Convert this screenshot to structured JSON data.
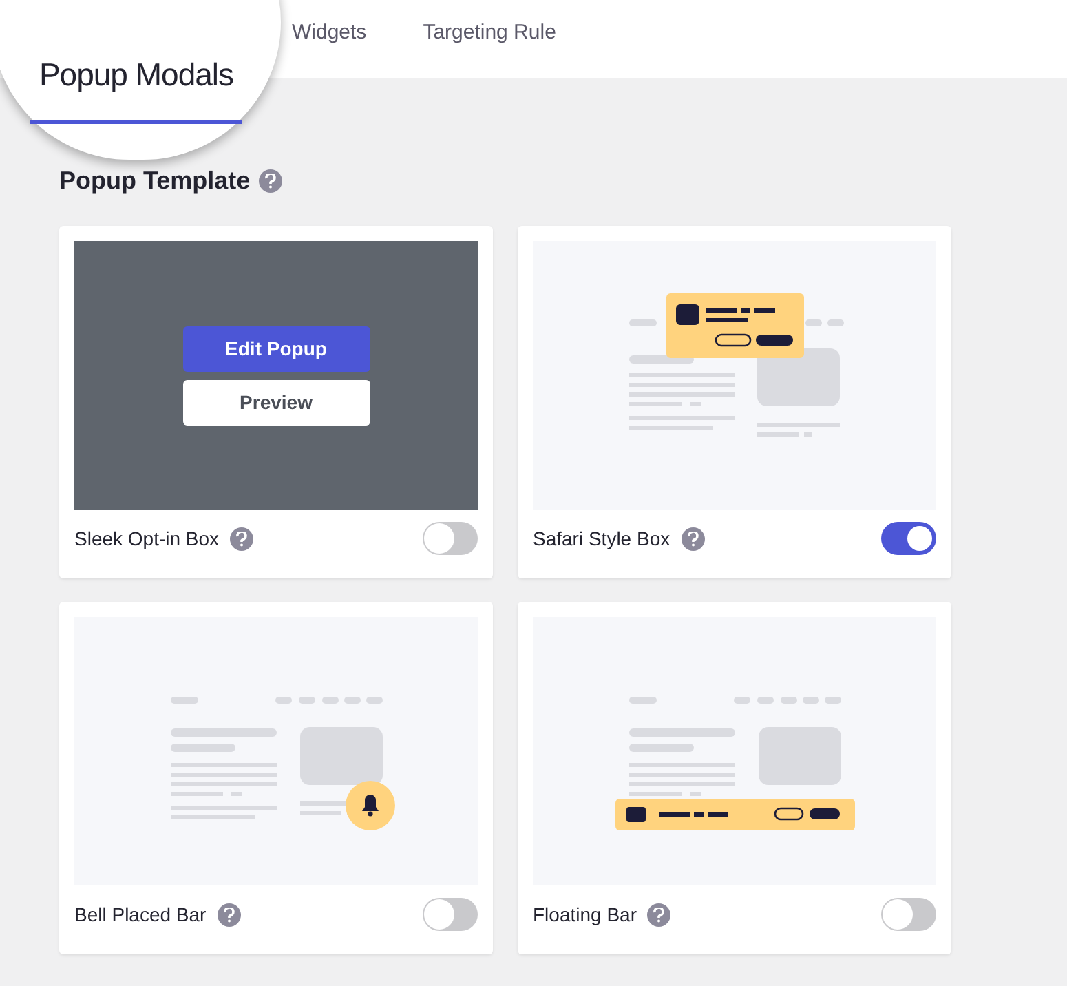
{
  "tabs": [
    {
      "label": "Popup Modals",
      "selected": true
    },
    {
      "label": "Widgets",
      "selected": false
    },
    {
      "label": "Targeting Rule",
      "selected": false
    }
  ],
  "section": {
    "title": "Popup Template"
  },
  "templates": [
    {
      "name": "Sleek Opt-in Box",
      "kind": "overlay",
      "enabled": false,
      "buttons": [
        "Edit Popup",
        "Preview"
      ]
    },
    {
      "name": "Safari Style Box",
      "kind": "safari",
      "enabled": true
    },
    {
      "name": "Bell Placed Bar",
      "kind": "bell",
      "enabled": false
    },
    {
      "name": "Floating Bar",
      "kind": "floating",
      "enabled": false
    }
  ]
}
